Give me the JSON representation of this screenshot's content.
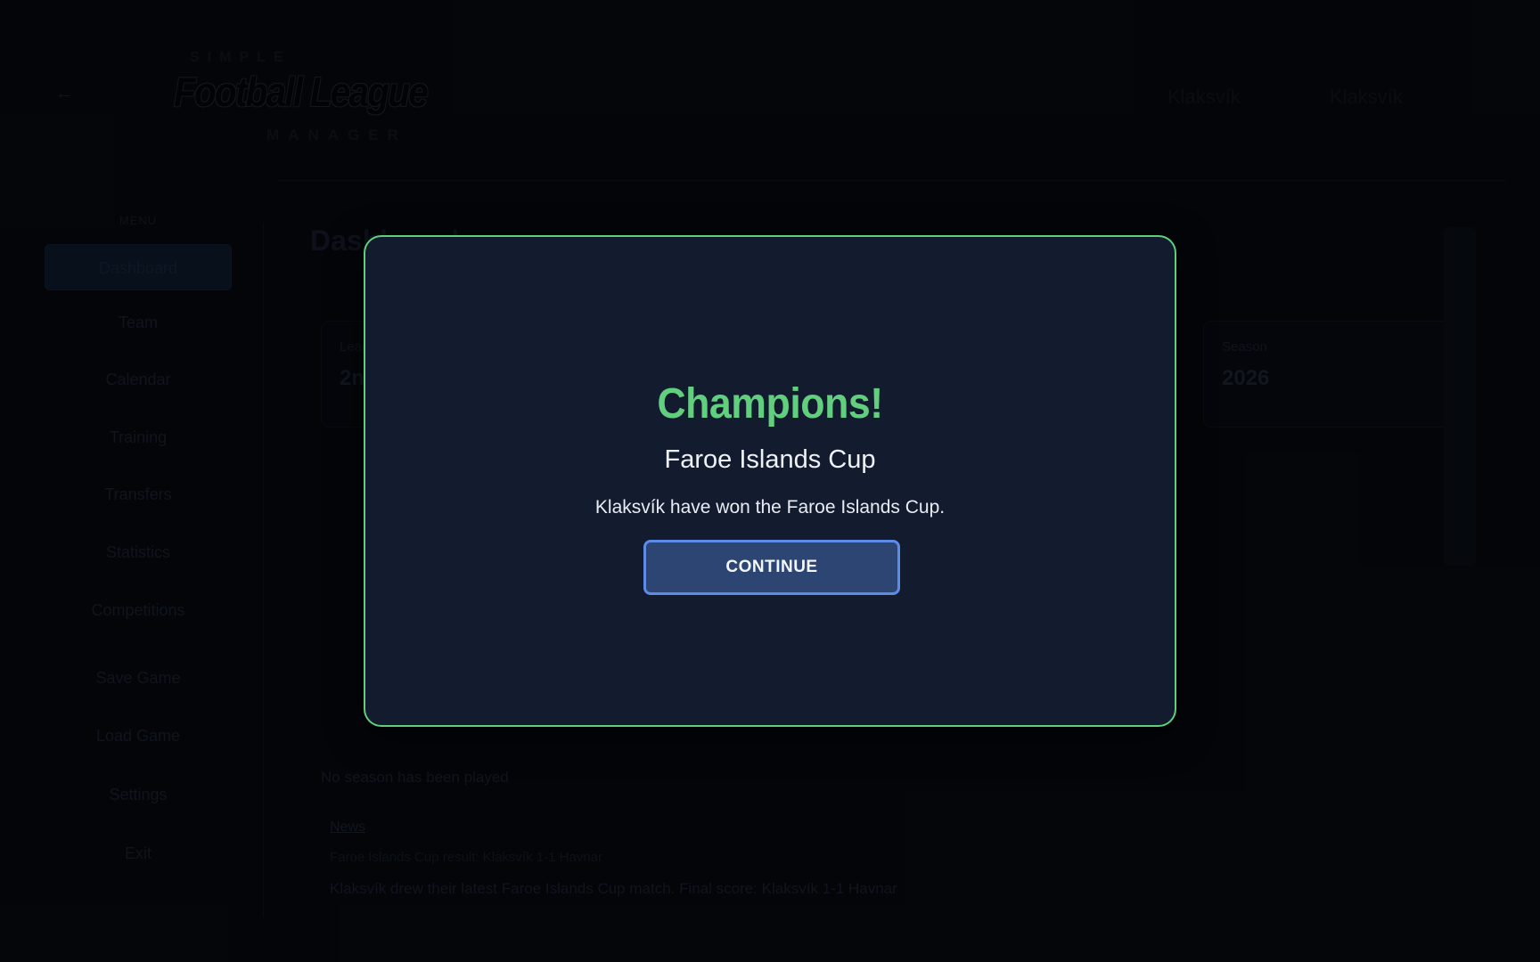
{
  "header": {
    "back_icon": "arrow-left-icon",
    "logo": {
      "top": "SIMPLE",
      "main": "Football League",
      "bottom": "MANAGER"
    },
    "right_a": "Klaksvík",
    "right_b": "Klaksvík"
  },
  "sidebar": {
    "heading": "MENU",
    "items": [
      {
        "label": "Dashboard",
        "active": true
      },
      {
        "label": "Team"
      },
      {
        "label": "Calendar"
      },
      {
        "label": "Training"
      },
      {
        "label": "Transfers"
      },
      {
        "label": "Statistics"
      },
      {
        "label": "Competitions"
      },
      {
        "label": "Save Game"
      },
      {
        "label": "Load Game"
      },
      {
        "label": "Settings"
      },
      {
        "label": "Exit"
      }
    ]
  },
  "main": {
    "title": "Dashboard",
    "subtitle": "",
    "stat_left": {
      "label": "League",
      "value": "2nd"
    },
    "stat_right": {
      "label": "Season",
      "value": "2026"
    },
    "no_season_text": "No season has been played",
    "news": {
      "heading": "News",
      "date_line": "Faroe Islands Cup result: Klaksvík 1-1 Havnar",
      "body": "Klaksvík drew their latest Faroe Islands Cup match. Final score: Klaksvík 1-1 Havnar"
    }
  },
  "modal": {
    "title": "Champions!",
    "subtitle": "Faroe Islands Cup",
    "message": "Klaksvík have won the Faroe Islands Cup.",
    "continue_label": "CONTINUE",
    "colors": {
      "accent": "#62cf7e",
      "button": "#2c4573",
      "button_border": "#5e8be6",
      "background": "#131c2f"
    }
  }
}
